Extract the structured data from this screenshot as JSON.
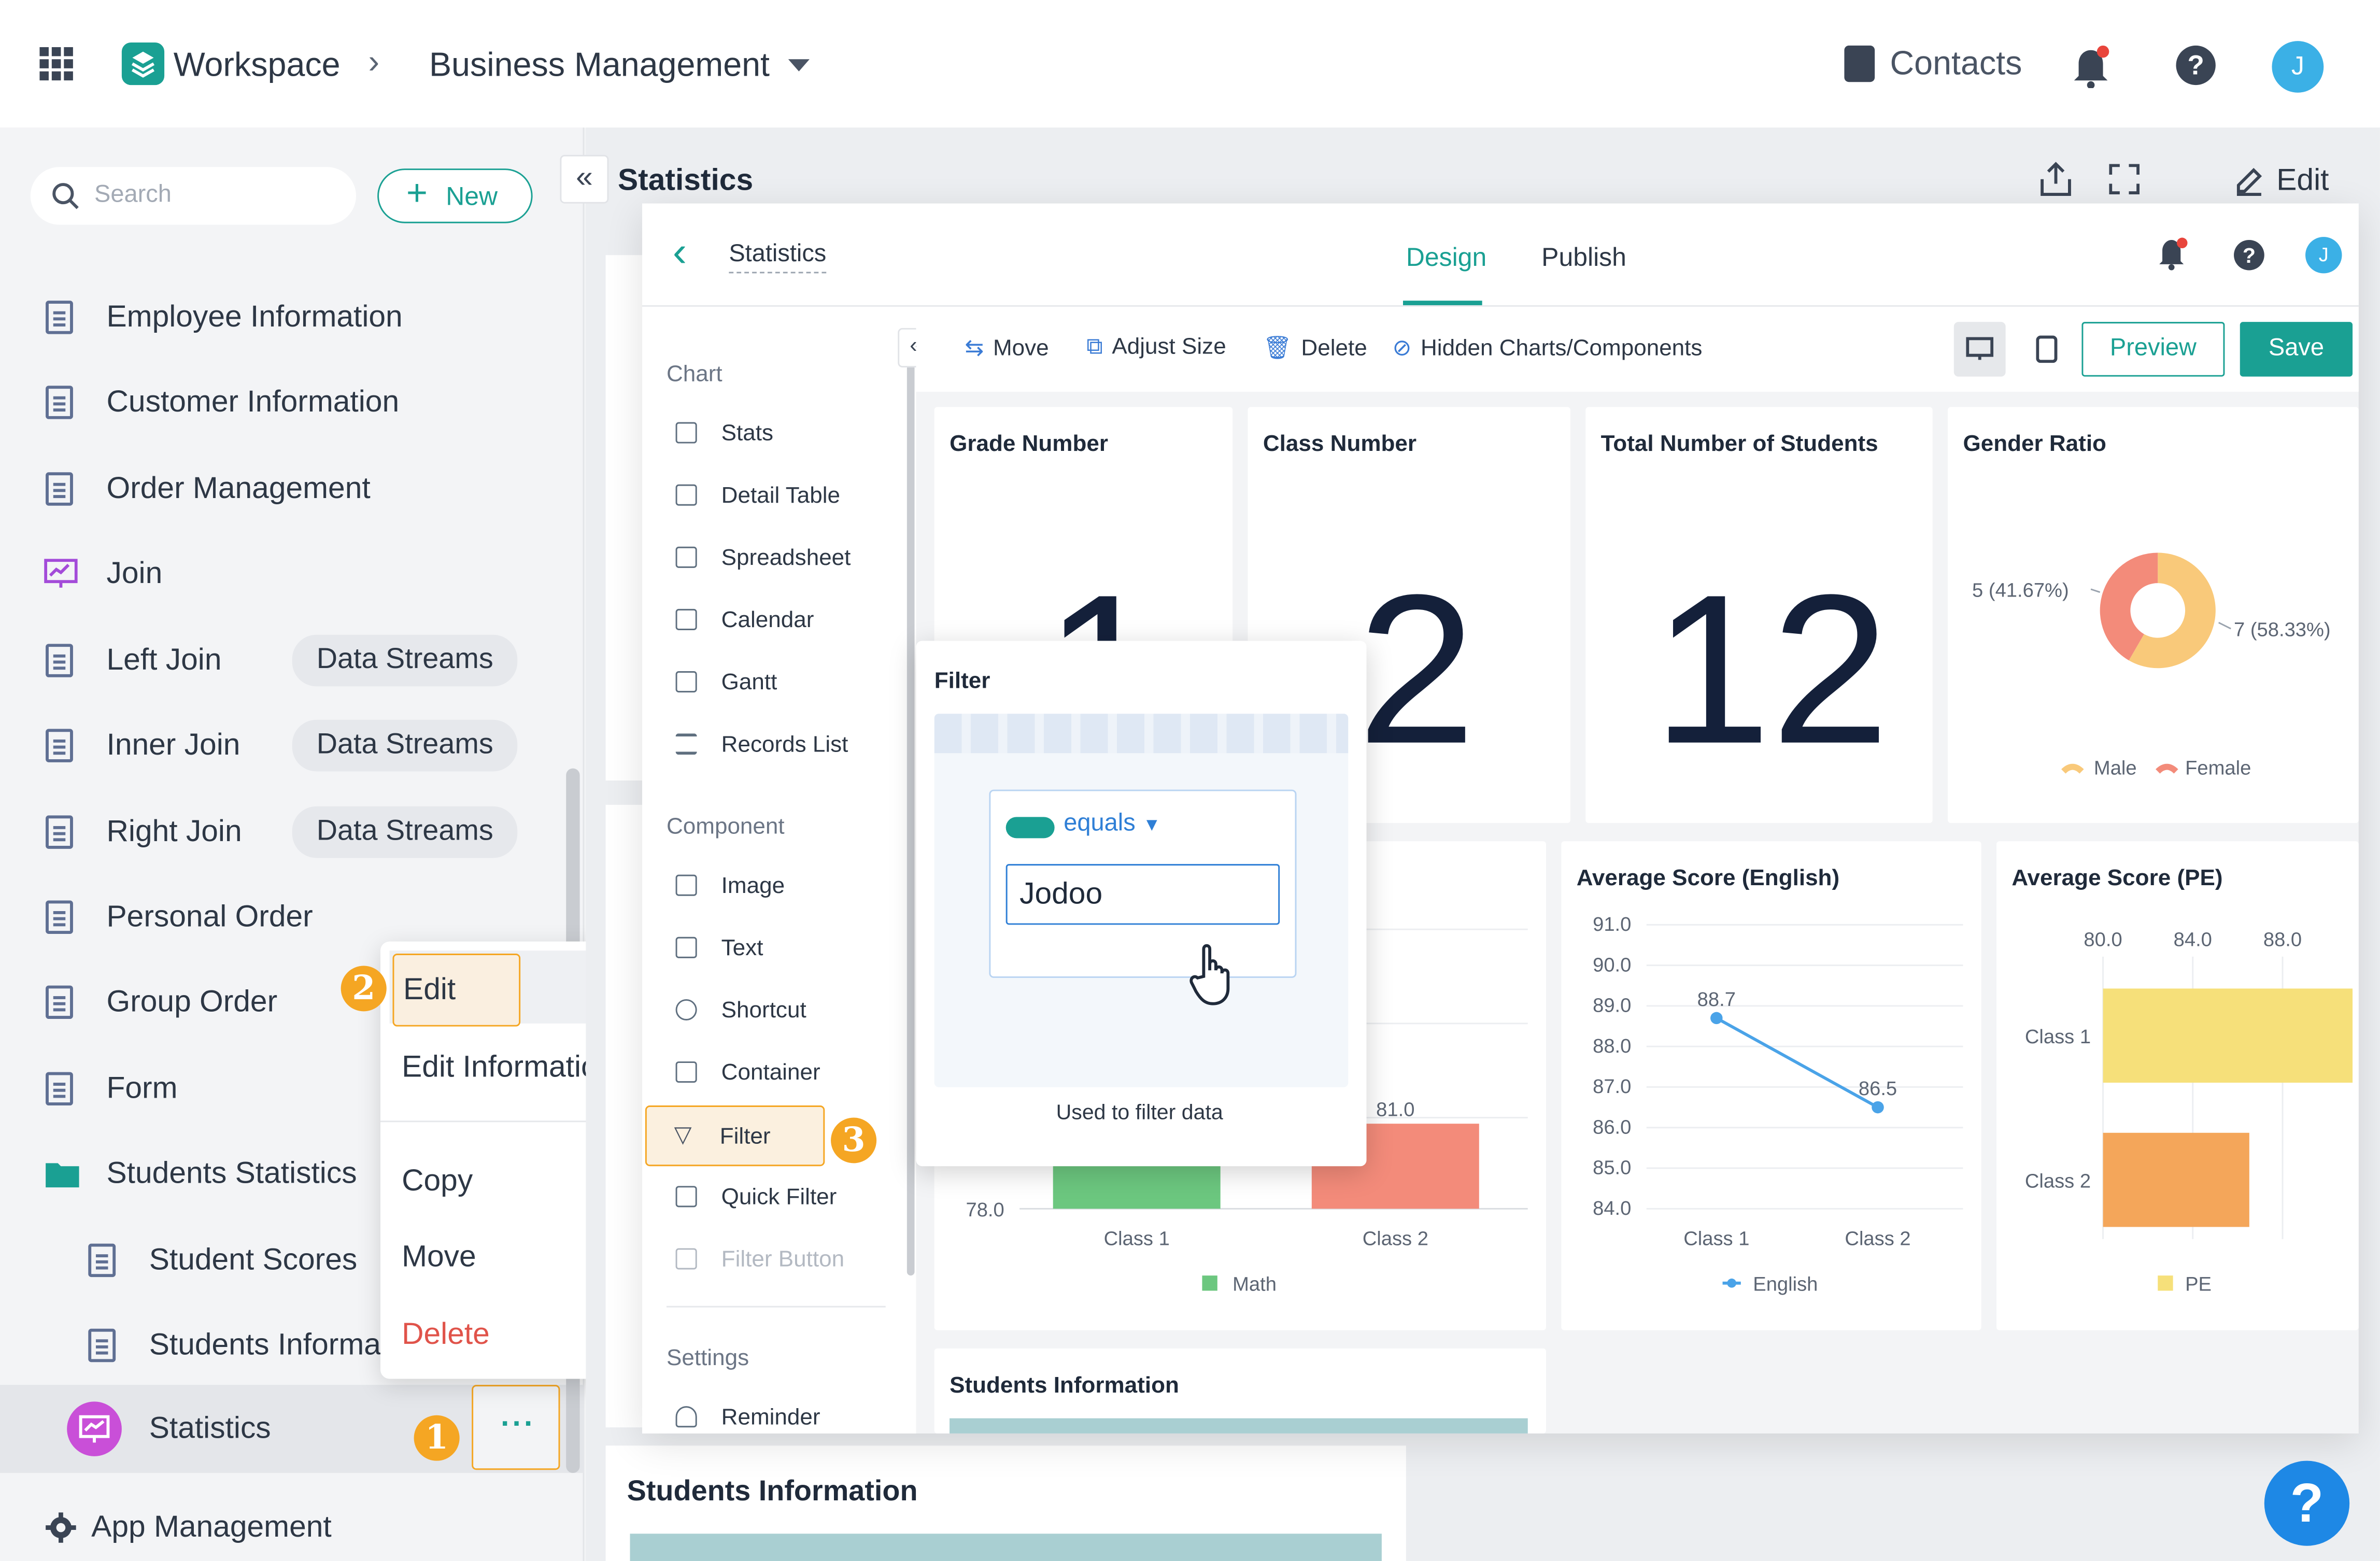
{
  "topbar": {
    "app_name": "Workspace",
    "breadcrumb": "Business Management",
    "contacts": "Contacts",
    "avatar": "J"
  },
  "sidebar": {
    "search_placeholder": "Search",
    "new_label": "New",
    "items": [
      {
        "label": "Employee Information"
      },
      {
        "label": "Customer Information"
      },
      {
        "label": "Order Management"
      },
      {
        "label": "Join"
      },
      {
        "label": "Left Join",
        "chip": "Data Streams"
      },
      {
        "label": "Inner Join",
        "chip": "Data Streams"
      },
      {
        "label": "Right Join",
        "chip": "Data Streams"
      },
      {
        "label": "Personal Order"
      },
      {
        "label": "Group Order"
      },
      {
        "label": "Form"
      },
      {
        "label": "Students Statistics"
      },
      {
        "label": "Student Scores"
      },
      {
        "label": "Students Informat"
      },
      {
        "label": "Statistics"
      }
    ],
    "app_management": "App Management"
  },
  "context_menu": {
    "edit": "Edit",
    "edit_information": "Edit Information",
    "copy": "Copy",
    "move": "Move",
    "delete": "Delete"
  },
  "badges": [
    "1",
    "2",
    "3"
  ],
  "main": {
    "title": "Statistics",
    "edit_label": "Edit",
    "bg_section_title": "Students Information"
  },
  "designer": {
    "back_title": "Statistics",
    "tabs": [
      "Design",
      "Publish"
    ],
    "avatar": "J",
    "left_panel": {
      "chart_header": "Chart",
      "chart_items": [
        "Stats",
        "Detail Table",
        "Spreadsheet",
        "Calendar",
        "Gantt",
        "Records List"
      ],
      "component_header": "Component",
      "component_items": [
        "Image",
        "Text",
        "Shortcut",
        "Container",
        "Filter",
        "Quick Filter",
        "Filter Button"
      ],
      "settings_header": "Settings",
      "settings_items": [
        "Reminder"
      ]
    },
    "toolbar": {
      "move": "Move",
      "adjust_size": "Adjust Size",
      "delete": "Delete",
      "hidden": "Hidden Charts/Components",
      "preview": "Preview",
      "save": "Save"
    },
    "cards": {
      "grade_title": "Grade Number",
      "grade_value": "1",
      "class_title": "Class Number",
      "class_value": "2",
      "total_title": "Total Number of Students",
      "total_value": "12",
      "gender_title": "Gender Ratio",
      "english_title": "Average Score (English)",
      "pe_title": "Average Score (PE)",
      "students_title": "Students Information"
    },
    "filter_popup": {
      "title": "Filter",
      "operator": "equals",
      "value": "Jodoo",
      "caption": "Used to filter data"
    }
  },
  "colors": {
    "accent": "#1aa093",
    "badge": "#f5a623",
    "delete": "#e0534a"
  },
  "chart_data": [
    {
      "type": "pie",
      "title": "Gender Ratio",
      "slices": [
        {
          "name": "Male",
          "value": 7,
          "label": "7 (58.33%)",
          "color": "#f9c97a"
        },
        {
          "name": "Female",
          "value": 5,
          "label": "5 (41.67%)",
          "color": "#f38b7a"
        }
      ]
    },
    {
      "type": "bar",
      "title": "",
      "categories": [
        "Class 1",
        "Class 2"
      ],
      "series": [
        {
          "name": "Math",
          "values": [
            null,
            81.0
          ],
          "color_by_category": [
            "#6cc77f",
            "#f38b7a"
          ]
        }
      ],
      "tick_labels": [
        "78.0"
      ],
      "data_labels": [
        "81.0"
      ],
      "ylim": [
        78.0,
        82.0
      ]
    },
    {
      "type": "line",
      "title": "Average Score (English)",
      "categories": [
        "Class 1",
        "Class 2"
      ],
      "series": [
        {
          "name": "English",
          "values": [
            88.7,
            86.5
          ]
        }
      ],
      "yticks": [
        "91.0",
        "90.0",
        "89.0",
        "88.0",
        "87.0",
        "86.0",
        "85.0",
        "84.0"
      ],
      "ylim": [
        84.0,
        91.0
      ]
    },
    {
      "type": "bar",
      "orientation": "horizontal",
      "title": "Average Score (PE)",
      "categories": [
        "Class 1",
        "Class 2"
      ],
      "series": [
        {
          "name": "PE",
          "values": [
            88.0,
            83.4
          ]
        }
      ],
      "xticks": [
        "80.0",
        "84.0",
        "88.0"
      ],
      "xlim": [
        80.0,
        88.0
      ]
    }
  ]
}
